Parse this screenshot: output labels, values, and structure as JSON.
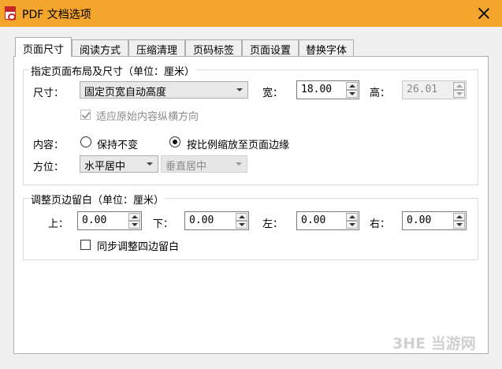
{
  "window": {
    "title": "PDF 文档选项"
  },
  "tabs": [
    {
      "label": "页面尺寸",
      "active": true
    },
    {
      "label": "阅读方式"
    },
    {
      "label": "压缩清理"
    },
    {
      "label": "页码标签"
    },
    {
      "label": "页面设置"
    },
    {
      "label": "替换字体"
    }
  ],
  "layout_group": {
    "title": "指定页面布局及尺寸（单位：厘米）",
    "size_label": "尺寸：",
    "size_value": "固定页宽自动高度",
    "width_label": "宽：",
    "width_value": "18.00",
    "height_label": "高：",
    "height_value": "26.01",
    "adapt_label": "适应原始内容纵横方向",
    "adapt_checked": true,
    "content_label": "内容：",
    "keep_label": "保持不变",
    "scale_label": "按比例缩放至页面边缘",
    "position_label": "方位：",
    "h_align_value": "水平居中",
    "v_align_value": "垂直居中"
  },
  "margin_group": {
    "title": "调整页边留白（单位：厘米）",
    "top_label": "上：",
    "top_value": "0.00",
    "bottom_label": "下：",
    "bottom_value": "0.00",
    "left_label": "左：",
    "left_value": "0.00",
    "right_label": "右：",
    "right_value": "0.00",
    "sync_label": "同步调整四边留白",
    "sync_checked": false
  },
  "watermark": "3HE 当游网"
}
